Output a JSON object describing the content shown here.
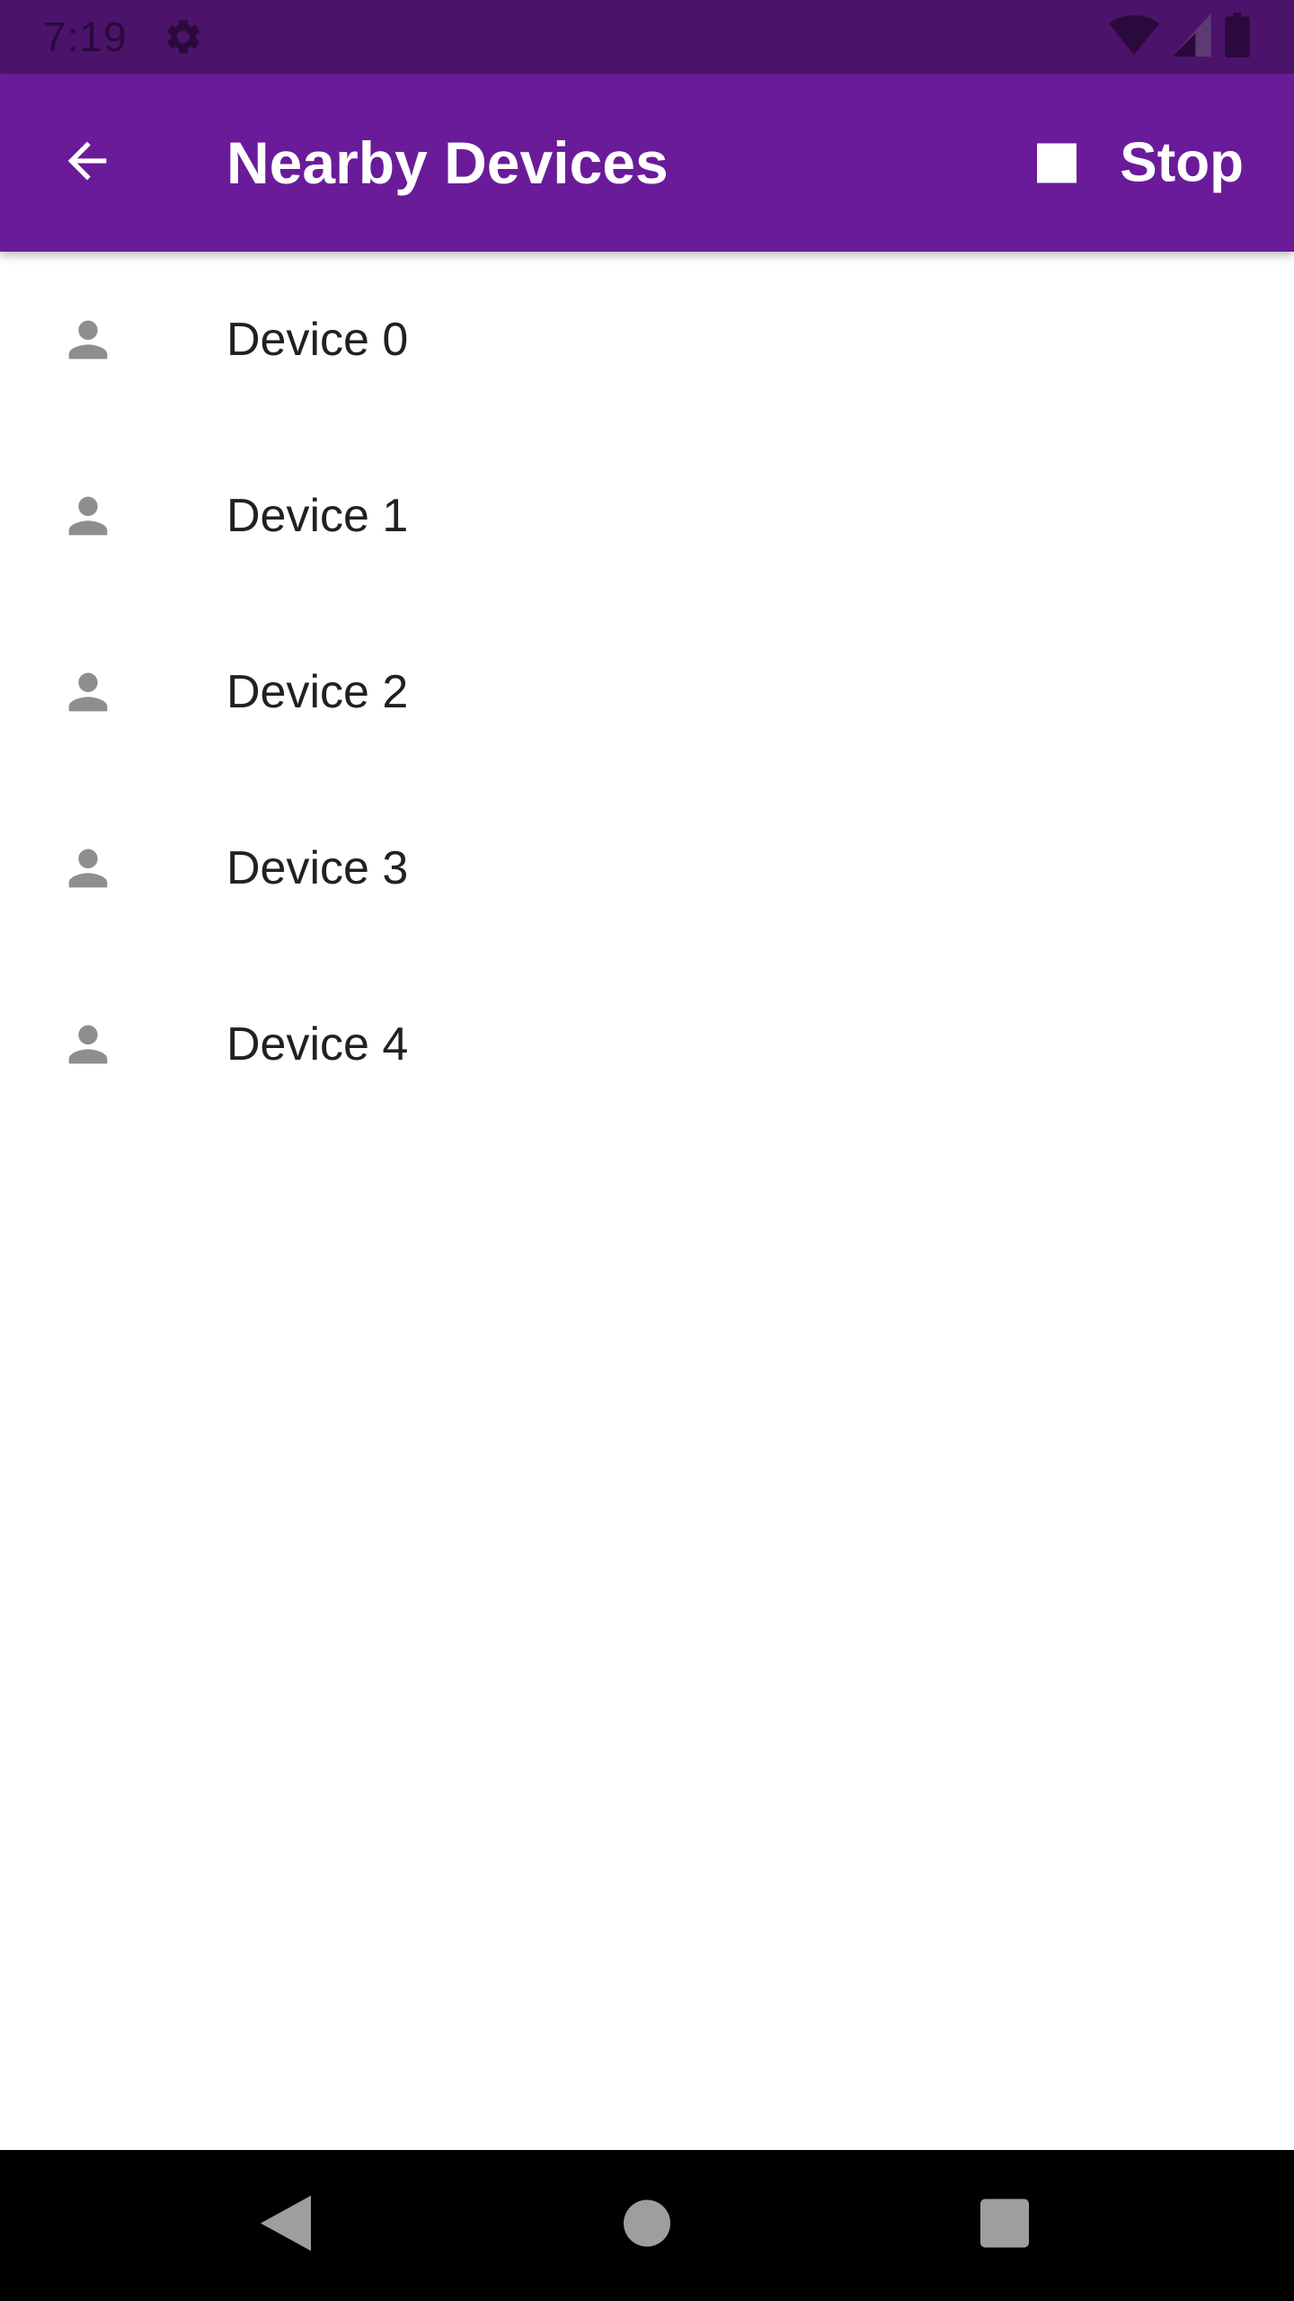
{
  "status_bar": {
    "time": "7:19",
    "icons": [
      "settings-gear-icon",
      "wifi-icon",
      "cell-signal-icon",
      "battery-icon"
    ],
    "background_color": "#4c136b"
  },
  "app_bar": {
    "title": "Nearby Devices",
    "back_icon": "arrow-back-icon",
    "action_icon": "stop-square-icon",
    "action_label": "Stop",
    "background_color": "#6a1b9a"
  },
  "devices": [
    {
      "label": "Device 0",
      "icon": "person-icon"
    },
    {
      "label": "Device 1",
      "icon": "person-icon"
    },
    {
      "label": "Device 2",
      "icon": "person-icon"
    },
    {
      "label": "Device 3",
      "icon": "person-icon"
    },
    {
      "label": "Device 4",
      "icon": "person-icon"
    }
  ],
  "nav_bar": {
    "buttons": [
      "nav-back-icon",
      "nav-home-icon",
      "nav-recents-icon"
    ]
  }
}
